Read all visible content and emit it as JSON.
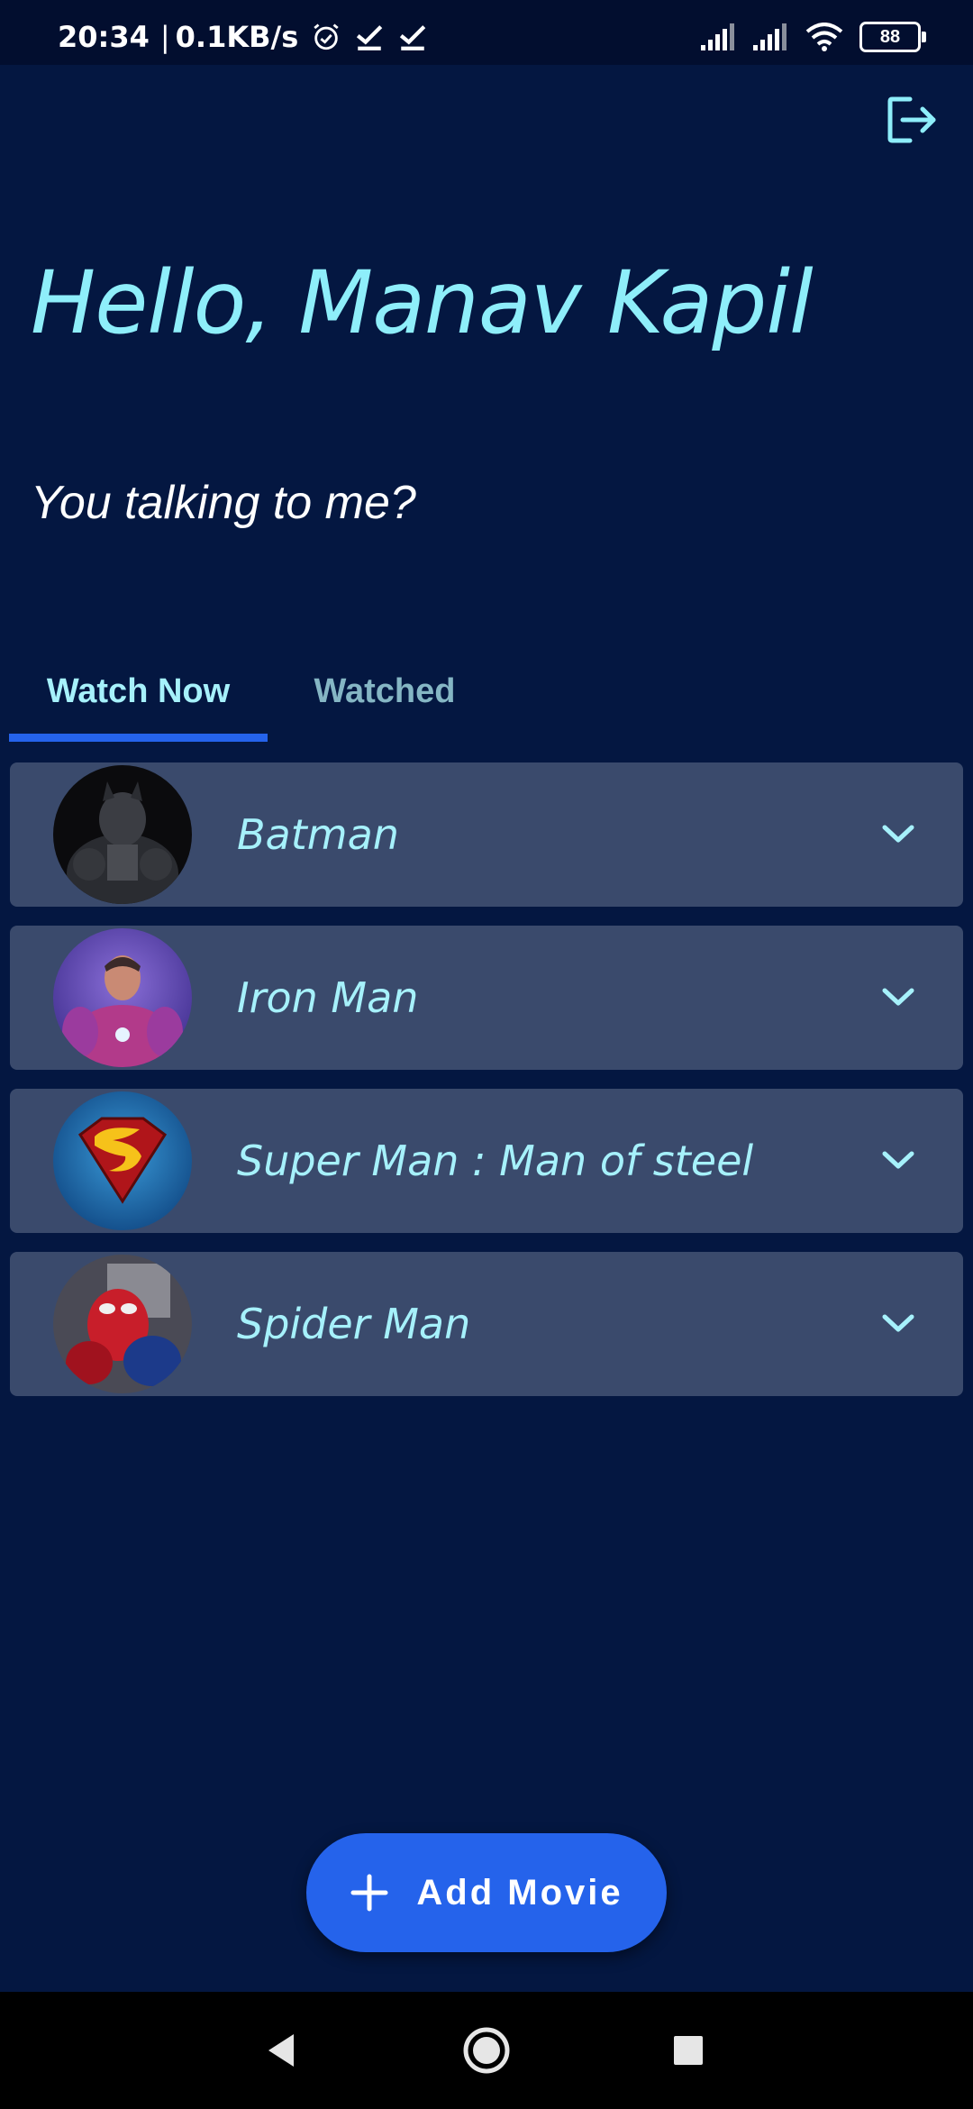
{
  "status_bar": {
    "time": "20:34",
    "separator": "|",
    "network_speed": "0.1KB/s",
    "battery_level": "88",
    "icons": [
      "alarm-icon",
      "check-icon",
      "check-icon",
      "signal-icon",
      "signal-icon",
      "wifi-icon",
      "battery-icon"
    ]
  },
  "header": {
    "logout_icon": "logout-icon"
  },
  "greeting": "Hello, Manav Kapil",
  "tagline": "You talking to me?",
  "tabs": [
    {
      "label": "Watch Now",
      "active": true
    },
    {
      "label": "Watched",
      "active": false
    }
  ],
  "movies": [
    {
      "title": "Batman"
    },
    {
      "title": "Iron Man"
    },
    {
      "title": "Super Man : Man of steel"
    },
    {
      "title": "Spider Man"
    }
  ],
  "fab": {
    "label": "Add Movie",
    "icon": "plus-icon"
  },
  "nav": {
    "back_icon": "back-icon",
    "home_icon": "home-icon",
    "recents_icon": "recents-icon"
  },
  "colors": {
    "background": "#041741",
    "accent": "#2563eb",
    "card": "#3a4a6c",
    "title_text": "#8eeefa"
  }
}
